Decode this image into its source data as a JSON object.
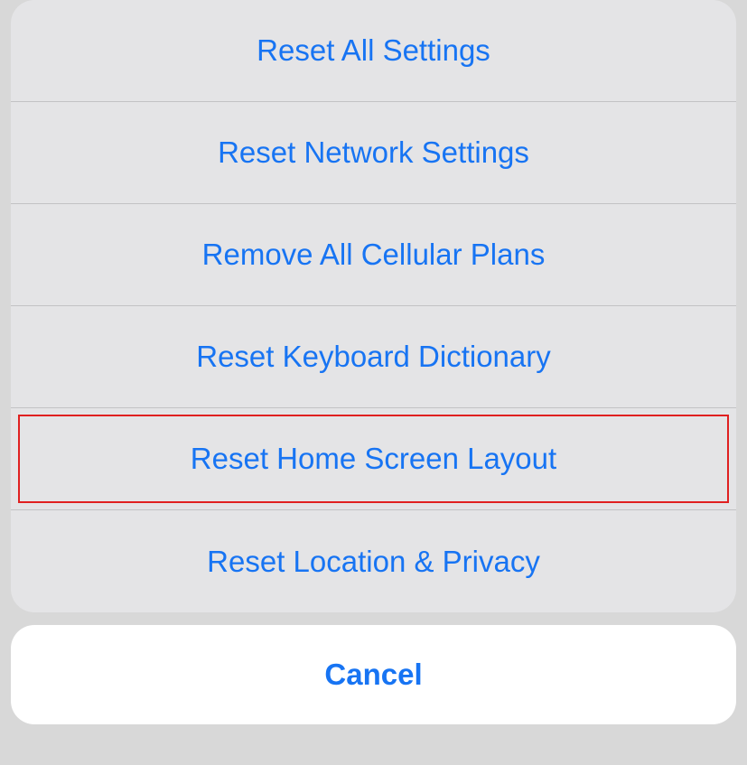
{
  "actionSheet": {
    "options": [
      {
        "label": "Reset All Settings",
        "highlighted": false
      },
      {
        "label": "Reset Network Settings",
        "highlighted": false
      },
      {
        "label": "Remove All Cellular Plans",
        "highlighted": false
      },
      {
        "label": "Reset Keyboard Dictionary",
        "highlighted": false
      },
      {
        "label": "Reset Home Screen Layout",
        "highlighted": true
      },
      {
        "label": "Reset Location & Privacy",
        "highlighted": false
      }
    ],
    "cancelLabel": "Cancel"
  },
  "colors": {
    "accent": "#1774f3",
    "highlight": "#e02020",
    "sheetBg": "#e4e4e6",
    "cancelBg": "#ffffff"
  }
}
